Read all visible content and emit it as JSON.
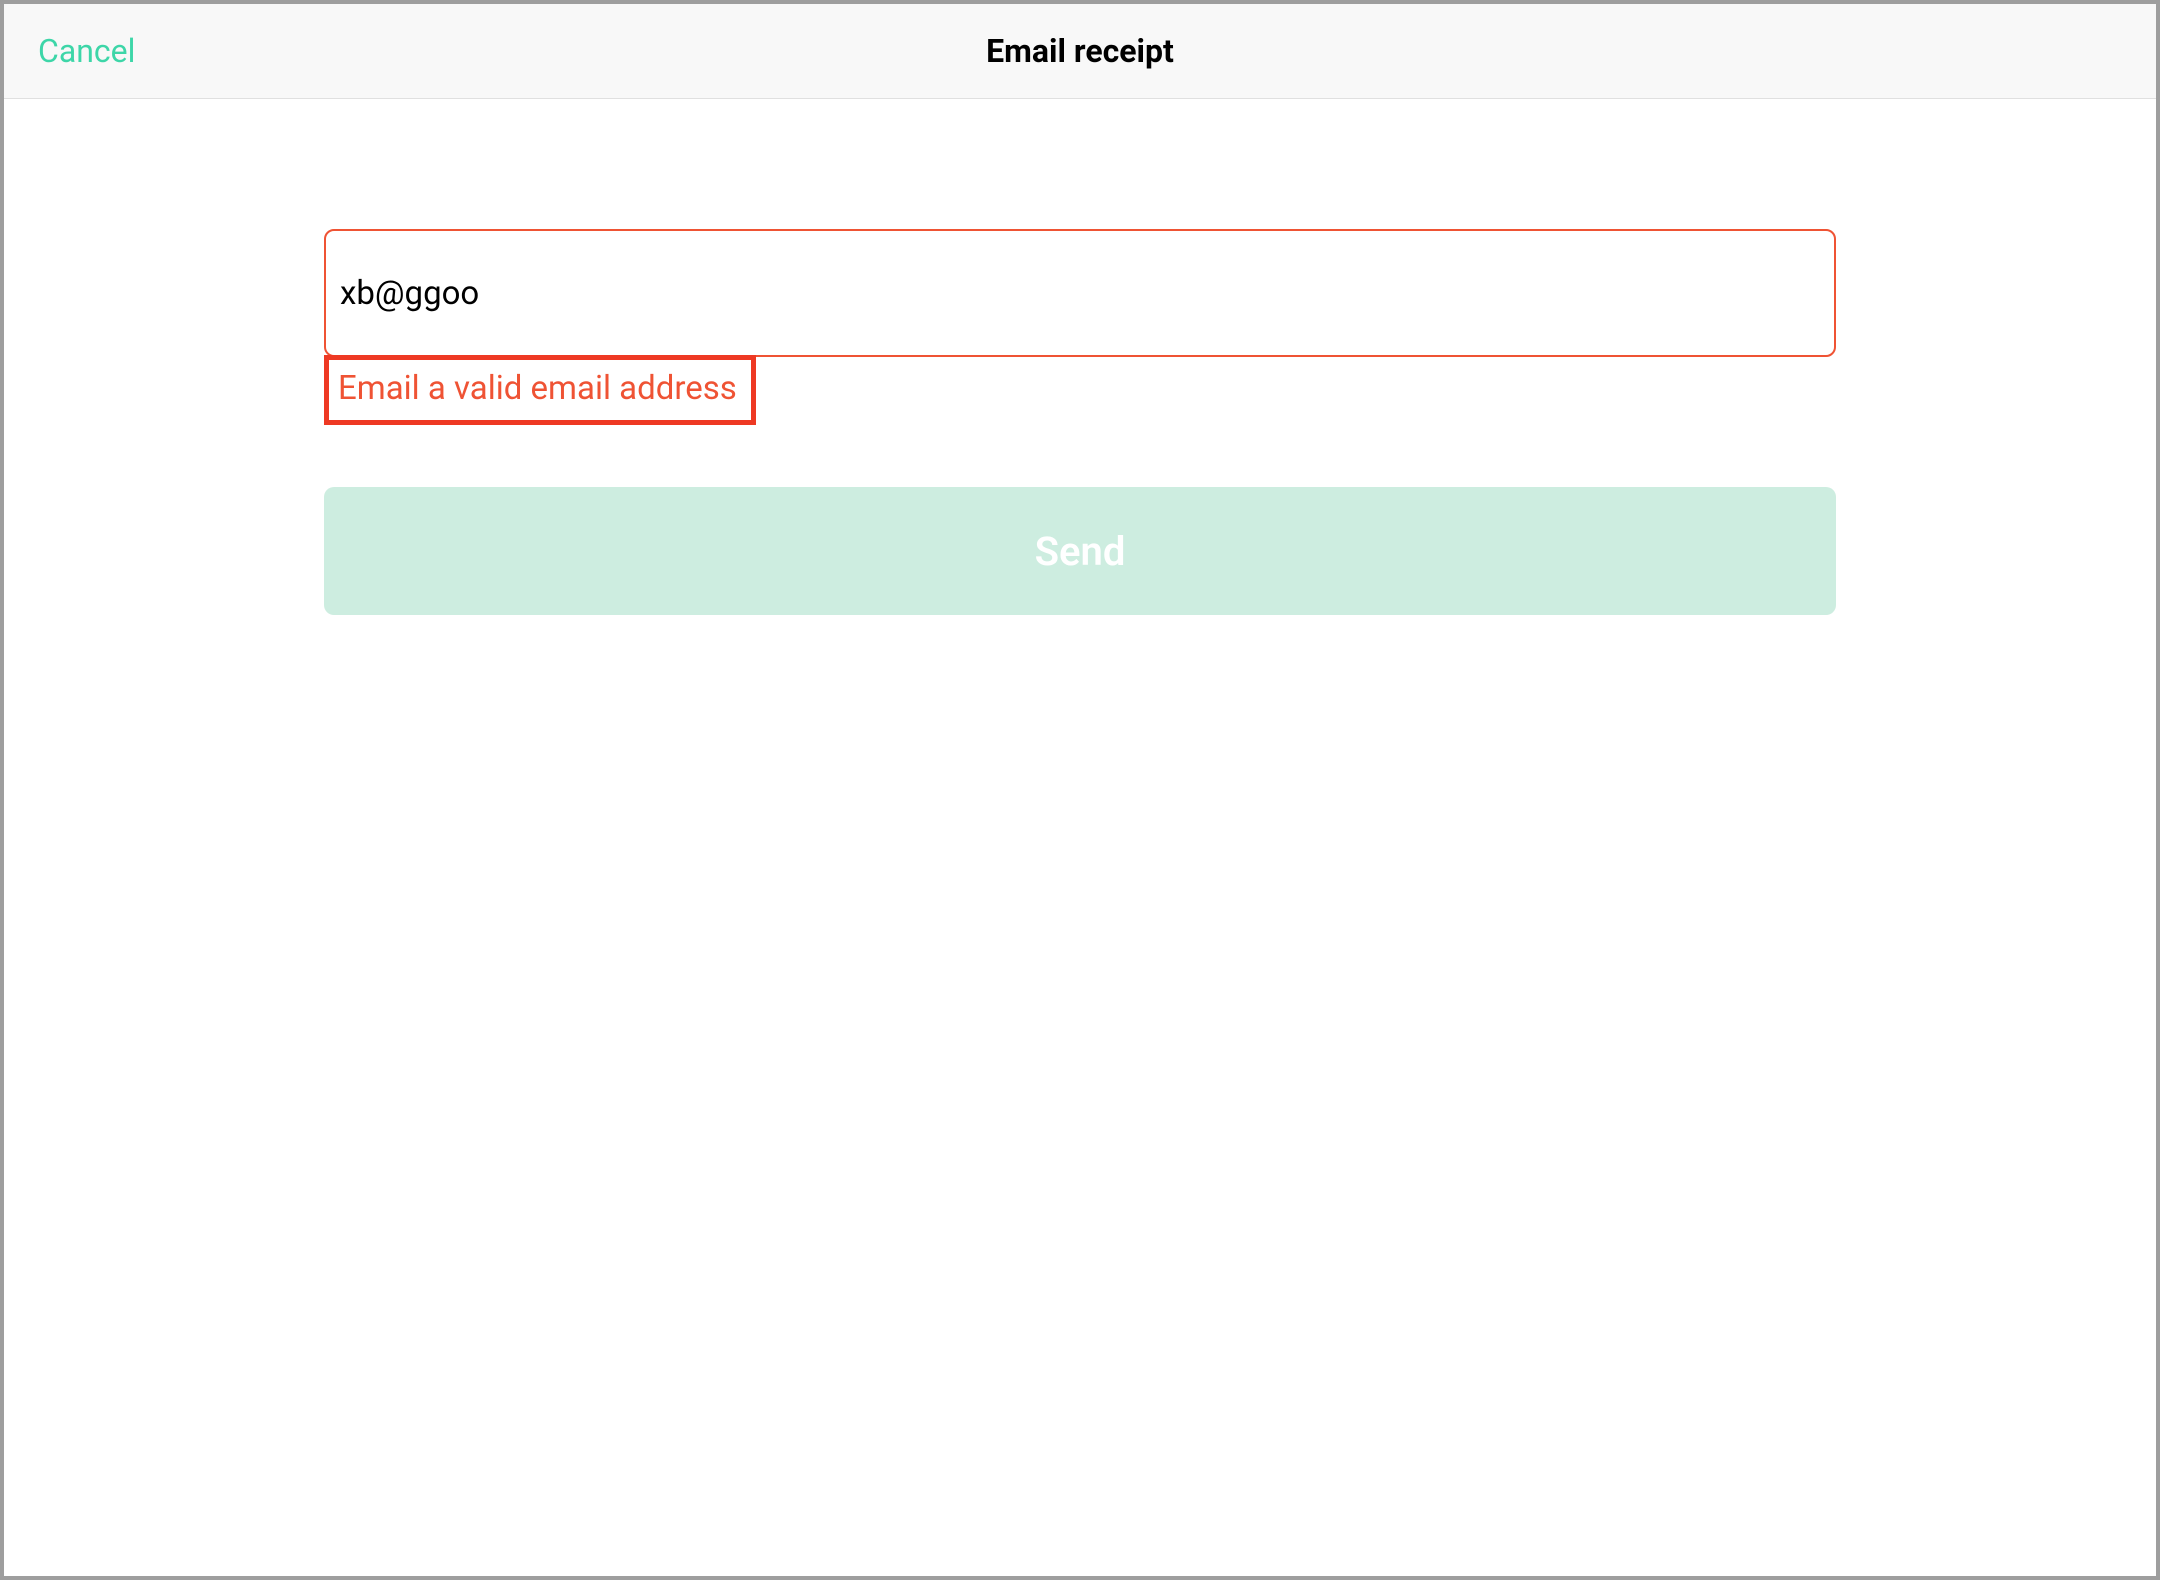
{
  "header": {
    "cancel_label": "Cancel",
    "title": "Email receipt"
  },
  "form": {
    "email_value": "xb@ggoo",
    "error_message": "Email a valid email address",
    "send_label": "Send"
  },
  "colors": {
    "accent": "#3dd6a8",
    "error_border": "#ef5334",
    "error_highlight": "#ee3923",
    "send_bg": "#cdede0"
  }
}
